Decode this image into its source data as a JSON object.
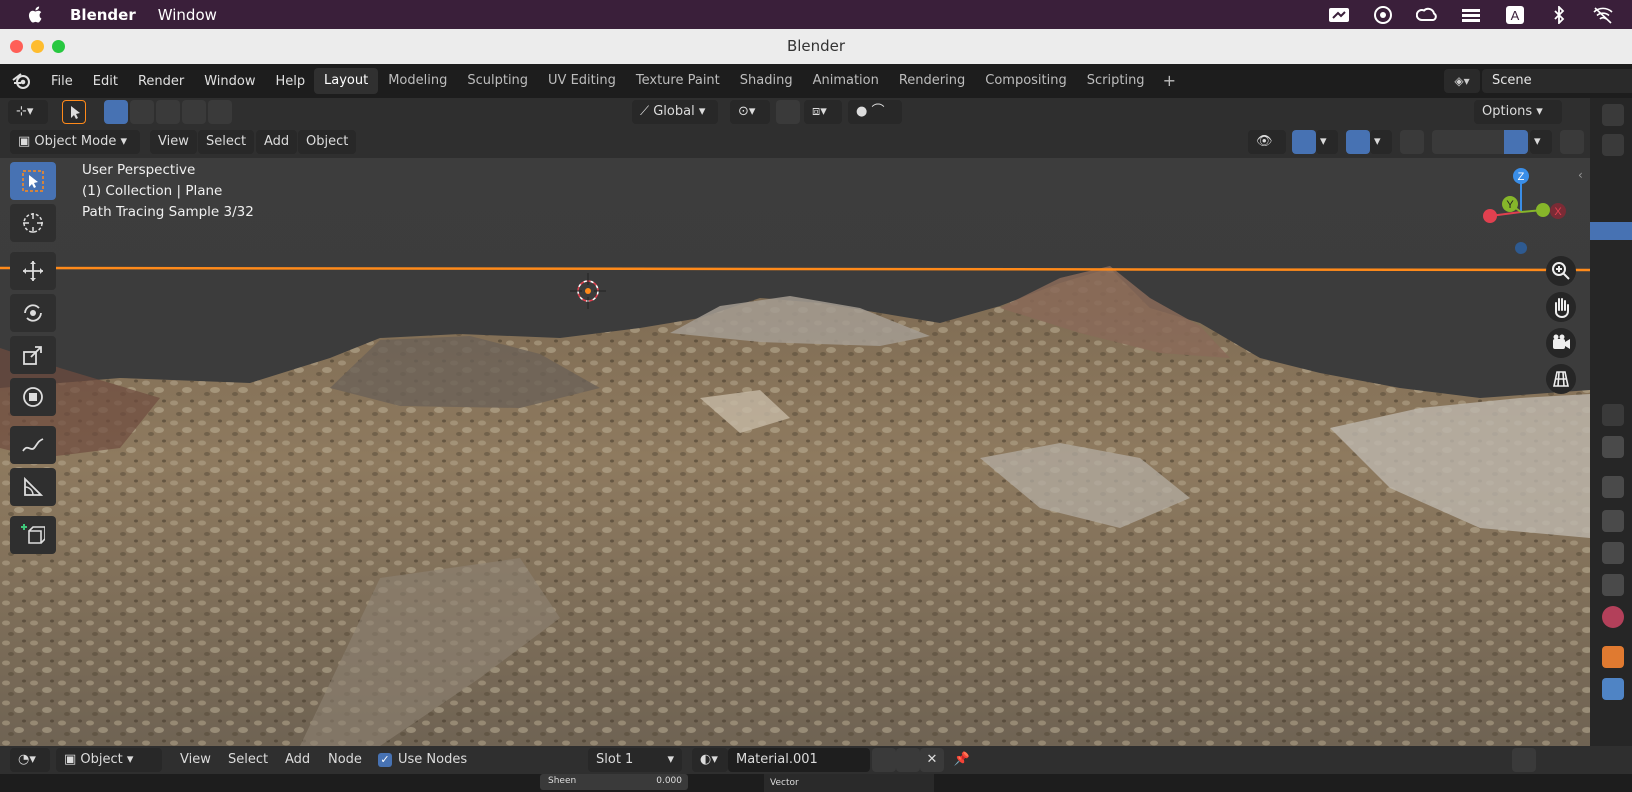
{
  "mac_menubar": {
    "app_name": "Blender",
    "menu": [
      "Window"
    ],
    "tray_icons": [
      "screen-icon",
      "overflow-icon",
      "creative-cloud-icon",
      "display-icon",
      "input-source-icon",
      "bluetooth-icon",
      "wifi-off-icon"
    ],
    "input_source_label": "A"
  },
  "window": {
    "title": "Blender"
  },
  "topbar": {
    "menus": [
      "File",
      "Edit",
      "Render",
      "Window",
      "Help"
    ],
    "workspace_tabs": [
      "Layout",
      "Modeling",
      "Sculpting",
      "UV Editing",
      "Texture Paint",
      "Shading",
      "Animation",
      "Rendering",
      "Compositing",
      "Scripting"
    ],
    "active_tab": "Layout",
    "scene_name": "Scene"
  },
  "viewport_header": {
    "transform_orientation": "Global",
    "options_label": "Options",
    "mode": "Object Mode",
    "menus": [
      "View",
      "Select",
      "Add",
      "Object"
    ]
  },
  "viewport": {
    "info_line1": "User Perspective",
    "info_line2": "(1) Collection | Plane",
    "info_line3": "Path Tracing Sample 3/32",
    "gizmo_axes": {
      "z": "Z",
      "y": "Y",
      "x": "X"
    },
    "colors": {
      "x_axis": "#e0404f",
      "y_axis": "#86b62a",
      "z_axis": "#3a8ee8",
      "selection": "#ff8a1a"
    }
  },
  "bottom_header": {
    "editor_type": "Object",
    "menus": [
      "View",
      "Select",
      "Add",
      "Node"
    ],
    "use_nodes_label": "Use Nodes",
    "use_nodes_checked": true,
    "slot": "Slot 1",
    "material": "Material.001"
  },
  "node_preview": {
    "sheen_label": "Sheen",
    "sheen_value": "0.000",
    "vector_label": "Vector"
  }
}
